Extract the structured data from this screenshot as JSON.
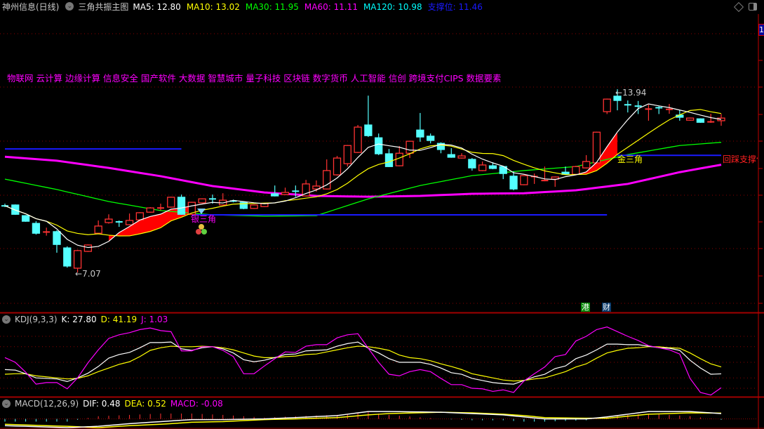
{
  "header": {
    "stock": "神州信息(日线)",
    "indicator": "三角共振主图",
    "items": [
      {
        "text": "MA5: 12.80",
        "color": "#ffffff"
      },
      {
        "text": "MA10: 13.02",
        "color": "#ffff00"
      },
      {
        "text": "MA30: 11.95",
        "color": "#00ff00"
      },
      {
        "text": "MA60: 11.11",
        "color": "#ff00ff"
      },
      {
        "text": "MA120: 10.98",
        "color": "#00ffff"
      },
      {
        "text": "支撑位: 11.46",
        "color": "#1a1aff"
      }
    ]
  },
  "concepts": "物联网 云计算 边缘计算 信息安全 国产软件 大数据 智慧城市 量子科技 区块链 数字货币 人工智能 信创 跨境支付CIPS 数据要素",
  "axis_badge": "1",
  "annotations": {
    "low": "7.07",
    "high": "13.94",
    "silver_triangle": "银三角",
    "gold_triangle": "金三角",
    "pullback_support": "回踩支撑位",
    "badge_hk": "港",
    "badge_fin": "财"
  },
  "kdj_header": {
    "name": "KDJ(9,3,3)",
    "k": "K: 27.80",
    "d": "D: 41.19",
    "j": "J: 1.03"
  },
  "macd_header": {
    "name": "MACD(12,26,9)",
    "dif": "DIF: 0.48",
    "dea": "DEA: 0.52",
    "macd": "MACD: -0.08"
  },
  "colors": {
    "up": "#ff3232",
    "down": "#54ffff",
    "ma5": "#ffffff",
    "ma10": "#ffff00",
    "ma30": "#00ff00",
    "ma60": "#ff00ff",
    "support": "#1a1aff",
    "fill": "#ff0000",
    "grid": "#8b0000"
  },
  "chart_data": [
    {
      "type": "candlestick",
      "title": "三角共振主图",
      "ylim": [
        5.57,
        16.76
      ],
      "candles": [
        [
          9.58,
          9.57,
          9.65,
          9.52
        ],
        [
          9.6,
          9.25,
          9.62,
          9.23
        ],
        [
          9.2,
          8.99,
          9.22,
          8.97
        ],
        [
          8.91,
          8.54,
          8.99,
          8.49
        ],
        [
          8.58,
          8.6,
          8.75,
          8.45
        ],
        [
          8.6,
          8.12,
          8.65,
          7.81
        ],
        [
          7.99,
          7.31,
          8.05,
          7.25
        ],
        [
          7.23,
          7.89,
          7.92,
          7.07
        ],
        [
          7.86,
          8.1,
          8.12,
          7.84
        ],
        [
          8.54,
          8.81,
          9.02,
          8.52
        ],
        [
          8.94,
          9.07,
          9.25,
          8.9
        ],
        [
          8.98,
          8.96,
          9.02,
          8.78
        ],
        [
          8.86,
          9.02,
          9.28,
          8.84
        ],
        [
          9.04,
          9.31,
          9.33,
          9.02
        ],
        [
          9.33,
          9.49,
          9.52,
          9.31
        ],
        [
          9.48,
          9.5,
          9.65,
          9.4
        ],
        [
          9.52,
          9.89,
          9.91,
          9.5
        ],
        [
          9.89,
          9.25,
          9.99,
          9.23
        ],
        [
          9.25,
          9.7,
          9.72,
          9.23
        ],
        [
          9.68,
          9.83,
          9.85,
          9.66
        ],
        [
          9.84,
          9.82,
          9.99,
          9.65
        ],
        [
          9.6,
          9.78,
          10.04,
          9.58
        ],
        [
          9.76,
          9.74,
          9.8,
          9.7
        ],
        [
          9.7,
          9.47,
          9.72,
          9.44
        ],
        [
          9.47,
          9.6,
          9.62,
          9.45
        ],
        [
          9.54,
          9.65,
          9.68,
          9.52
        ],
        [
          10.02,
          9.94,
          10.33,
          9.92
        ],
        [
          9.99,
          10.07,
          10.25,
          9.97
        ],
        [
          10.13,
          10.11,
          10.33,
          9.91
        ],
        [
          9.94,
          10.39,
          10.54,
          9.92
        ],
        [
          10.2,
          10.31,
          10.52,
          10.1
        ],
        [
          10.2,
          10.89,
          11.31,
          10.18
        ],
        [
          10.73,
          11.36,
          11.44,
          10.7
        ],
        [
          11.15,
          11.83,
          11.85,
          11.04
        ],
        [
          11.57,
          12.52,
          12.6,
          11.55
        ],
        [
          12.6,
          12.2,
          13.7,
          12.15
        ],
        [
          12.12,
          11.52,
          12.28,
          11.47
        ],
        [
          11.52,
          11.04,
          11.7,
          11.02
        ],
        [
          11.07,
          11.54,
          11.81,
          11.05
        ],
        [
          11.54,
          11.99,
          12.01,
          11.36
        ],
        [
          12.41,
          12.15,
          13.05,
          11.97
        ],
        [
          12.18,
          12.02,
          12.28,
          11.91
        ],
        [
          11.91,
          11.68,
          11.95,
          11.54
        ],
        [
          11.49,
          11.39,
          11.73,
          11.37
        ],
        [
          11.36,
          11.44,
          11.54,
          11.34
        ],
        [
          11.31,
          10.99,
          11.36,
          10.89
        ],
        [
          10.89,
          11.1,
          11.23,
          10.87
        ],
        [
          11.07,
          10.97,
          11.2,
          10.94
        ],
        [
          11.04,
          10.78,
          11.07,
          10.57
        ],
        [
          10.68,
          10.2,
          10.86,
          10.15
        ],
        [
          10.36,
          10.7,
          10.72,
          10.34
        ],
        [
          10.66,
          10.68,
          10.78,
          10.39
        ],
        [
          10.51,
          10.53,
          11.04,
          10.49
        ],
        [
          10.57,
          10.65,
          10.67,
          10.28
        ],
        [
          10.83,
          10.75,
          11.04,
          10.73
        ],
        [
          10.75,
          11.04,
          11.07,
          10.73
        ],
        [
          10.99,
          11.23,
          11.47,
          10.97
        ],
        [
          11.18,
          12.33,
          12.35,
          11.16
        ],
        [
          13.1,
          13.57,
          13.59,
          13.01
        ],
        [
          13.68,
          13.52,
          13.94,
          13.15
        ],
        [
          13.37,
          13.35,
          13.52,
          13.07
        ],
        [
          13.32,
          13.3,
          13.5,
          13.01
        ],
        [
          13.19,
          13.21,
          13.36,
          12.76
        ],
        [
          13.26,
          13.2,
          13.3,
          13.01
        ],
        [
          13.15,
          13.2,
          13.39,
          13.02
        ],
        [
          12.97,
          12.89,
          13.15,
          12.76
        ],
        [
          12.78,
          12.86,
          12.88,
          12.76
        ],
        [
          12.83,
          12.7,
          12.85,
          12.68
        ],
        [
          12.7,
          12.73,
          13.02,
          12.68
        ],
        [
          12.76,
          12.86,
          13.01,
          12.57
        ]
      ],
      "ma30": [
        [
          0,
          10.57
        ],
        [
          5,
          10.18
        ],
        [
          10,
          9.73
        ],
        [
          15,
          9.39
        ],
        [
          20,
          9.23
        ],
        [
          25,
          9.18
        ],
        [
          30,
          9.2
        ],
        [
          35,
          9.83
        ],
        [
          40,
          10.33
        ],
        [
          45,
          10.7
        ],
        [
          50,
          10.89
        ],
        [
          55,
          11.04
        ],
        [
          60,
          11.49
        ],
        [
          65,
          11.83
        ],
        [
          69,
          11.95
        ]
      ],
      "ma60": [
        [
          0,
          11.41
        ],
        [
          5,
          11.26
        ],
        [
          10,
          10.99
        ],
        [
          15,
          10.68
        ],
        [
          20,
          10.31
        ],
        [
          25,
          10.07
        ],
        [
          30,
          9.94
        ],
        [
          35,
          9.91
        ],
        [
          40,
          9.94
        ],
        [
          45,
          10.02
        ],
        [
          50,
          10.04
        ],
        [
          55,
          10.15
        ],
        [
          60,
          10.39
        ],
        [
          65,
          10.83
        ],
        [
          69,
          11.11
        ]
      ],
      "support_lines": [
        {
          "price": 11.7,
          "from": 0,
          "to": 17
        },
        {
          "price": 9.23,
          "from": 18,
          "to": 58
        },
        {
          "price": 11.46,
          "from": 59,
          "to": 69
        }
      ],
      "triangle_zones": [
        [
          10,
          18
        ],
        [
          55,
          59
        ]
      ],
      "gridlines": true
    },
    {
      "type": "line",
      "title": "KDJ(9,3,3)",
      "ylim": [
        -13.5,
        144.6
      ],
      "gridlines": [
        100,
        80,
        50,
        20,
        0
      ],
      "k": [
        36,
        35,
        28,
        20,
        19,
        18,
        13,
        20,
        29,
        42,
        58,
        65,
        69,
        78,
        88,
        88,
        89,
        76,
        73,
        78,
        80,
        76,
        68,
        55,
        51,
        54,
        59,
        65,
        66,
        72,
        73,
        74,
        81,
        86,
        89,
        77,
        68,
        57,
        50,
        50,
        50,
        46,
        39,
        30,
        27,
        19,
        15,
        11,
        9,
        8,
        15,
        22,
        27,
        38,
        43,
        57,
        64,
        74,
        85,
        85,
        84,
        84,
        81,
        78,
        77,
        73,
        54,
        39,
        27,
        27.8
      ],
      "d": [
        27,
        28,
        28,
        24,
        22,
        20,
        18,
        19,
        24,
        32,
        39,
        46,
        51,
        61,
        73,
        78,
        81,
        80,
        80,
        81,
        80,
        78,
        74,
        68,
        62,
        59,
        59,
        61,
        62,
        65,
        66,
        70,
        74,
        78,
        81,
        80,
        77,
        73,
        64,
        59,
        57,
        53,
        47,
        42,
        36,
        28,
        24,
        20,
        16,
        14,
        15,
        18,
        20,
        26,
        32,
        41,
        47,
        58,
        68,
        73,
        77,
        78,
        80,
        80,
        78,
        77,
        68,
        57,
        47,
        41.19
      ],
      "j": [
        59,
        50,
        31,
        8,
        11,
        11,
        -1,
        20,
        49,
        74,
        96,
        103,
        107,
        113,
        116,
        111,
        109,
        72,
        72,
        80,
        80,
        73,
        61,
        28,
        28,
        43,
        57,
        70,
        69,
        81,
        84,
        84,
        97,
        103,
        105,
        77,
        50,
        27,
        24,
        32,
        36,
        32,
        19,
        7,
        7,
        0,
        -1,
        -6,
        -3,
        -8,
        14,
        28,
        41,
        61,
        65,
        91,
        100,
        113,
        118,
        109,
        100,
        92,
        82,
        78,
        74,
        66,
        19,
        -8,
        -13,
        1.03
      ]
    },
    {
      "type": "line+bar",
      "title": "MACD(12,26,9)",
      "ylim": [
        -0.9,
        1.92
      ],
      "dif": [
        [
          0,
          -0.6
        ],
        [
          6,
          -0.78
        ],
        [
          9,
          -0.66
        ],
        [
          12,
          -0.42
        ],
        [
          15,
          -0.24
        ],
        [
          18,
          -0.06
        ],
        [
          21,
          -0.06
        ],
        [
          25,
          0
        ],
        [
          28,
          0.12
        ],
        [
          32,
          0.3
        ],
        [
          35,
          0.66
        ],
        [
          37,
          0.66
        ],
        [
          42,
          0.6
        ],
        [
          45,
          0.48
        ],
        [
          48,
          0.36
        ],
        [
          50,
          0.18
        ],
        [
          52,
          0
        ],
        [
          56,
          0
        ],
        [
          58,
          0.18
        ],
        [
          60,
          0.42
        ],
        [
          62,
          0.66
        ],
        [
          66,
          0.66
        ],
        [
          69,
          0.48
        ]
      ],
      "dea": [
        [
          0,
          -0.48
        ],
        [
          6,
          -0.66
        ],
        [
          9,
          -0.78
        ],
        [
          12,
          -0.6
        ],
        [
          15,
          -0.48
        ],
        [
          18,
          -0.3
        ],
        [
          21,
          -0.24
        ],
        [
          25,
          -0.06
        ],
        [
          28,
          0
        ],
        [
          32,
          0.12
        ],
        [
          35,
          0.36
        ],
        [
          37,
          0.48
        ],
        [
          42,
          0.6
        ],
        [
          45,
          0.54
        ],
        [
          48,
          0.42
        ],
        [
          50,
          0.3
        ],
        [
          52,
          0.12
        ],
        [
          56,
          0.06
        ],
        [
          58,
          0.06
        ],
        [
          60,
          0.24
        ],
        [
          62,
          0.42
        ],
        [
          66,
          0.54
        ],
        [
          69,
          0.52
        ]
      ]
    }
  ]
}
